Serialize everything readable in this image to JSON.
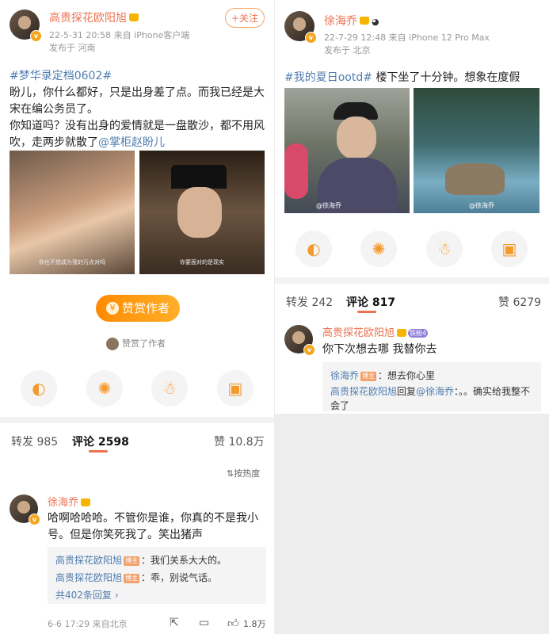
{
  "left_post": {
    "author": "高贵探花欧阳旭",
    "follow_label": "+关注",
    "time": "22-5-31 20:58",
    "source": "来自 iPhone客户端",
    "location": "发布于 河南",
    "hashtag": "#梦华录定档0602#",
    "body_1": "盼儿，你什么都好，只是出身差了点。而我已经是大宋在编公务员了。",
    "body_2": "你知道吗？没有出身的爱情就是一盘散沙，都不用风吹，走两步就散了",
    "mention": "@掌柜赵盼儿",
    "image1_caption": "你也不想成为我的污点对吗",
    "image2_caption": "你要面对的是现实",
    "reward_label": "赞赏作者",
    "reward_note": "赞赏了作者"
  },
  "left_tabs": {
    "forward_label": "转发",
    "forward_count": "985",
    "comment_label": "评论",
    "comment_count": "2598",
    "like_label": "赞",
    "like_count": "10.8万"
  },
  "sort_label": "按热度",
  "left_comment": {
    "author": "徐海乔",
    "text": "哈啊哈哈哈。不管你是谁，你真的不是我小号。但是你笑死我了。笑出猪声",
    "reply1_name": "高贵探花欧阳旭",
    "reply1_tag": "博主",
    "reply1_text": "：我们关系大大的。",
    "reply2_name": "高贵探花欧阳旭",
    "reply2_tag": "博主",
    "reply2_text": "：乖，别说气话。",
    "more_replies": "共402条回复",
    "time": "6-6 17:29",
    "location": "来自北京",
    "likes": "1.8万"
  },
  "right_post": {
    "author": "徐海乔",
    "time": "22-7-29 12:48",
    "source": "来自 iPhone 12 Pro Max",
    "location": "发布于 北京",
    "hashtag": "#我的夏日ootd#",
    "body": " 楼下坐了十分钟。想象在度假",
    "watermark": "@徐海乔"
  },
  "right_tabs": {
    "forward_label": "转发",
    "forward_count": "242",
    "comment_label": "评论",
    "comment_count": "817",
    "like_label": "赞",
    "like_count": "6279"
  },
  "right_comment": {
    "author": "高贵探花欧阳旭",
    "fan_badge": "铁粉4",
    "text": "你下次想去哪 我替你去",
    "reply1_name": "徐海乔",
    "reply1_tag": "博主",
    "reply1_text": "：想去你心里",
    "reply2_name": "高贵探花欧阳旭",
    "reply2_mid": "回复",
    "reply2_mention": "@徐海乔",
    "reply2_text": "：。。确实给我整不会了"
  },
  "icons": [
    "wechat-icon",
    "moments-icon",
    "qq-icon",
    "save-image-icon",
    "star-icon",
    "chevron-right-icon",
    "sort-icon",
    "forward-icon",
    "comment-icon",
    "like-icon"
  ],
  "colors": {
    "name": "#eb7350",
    "link": "#507daf",
    "reward": "#ff8a00"
  }
}
